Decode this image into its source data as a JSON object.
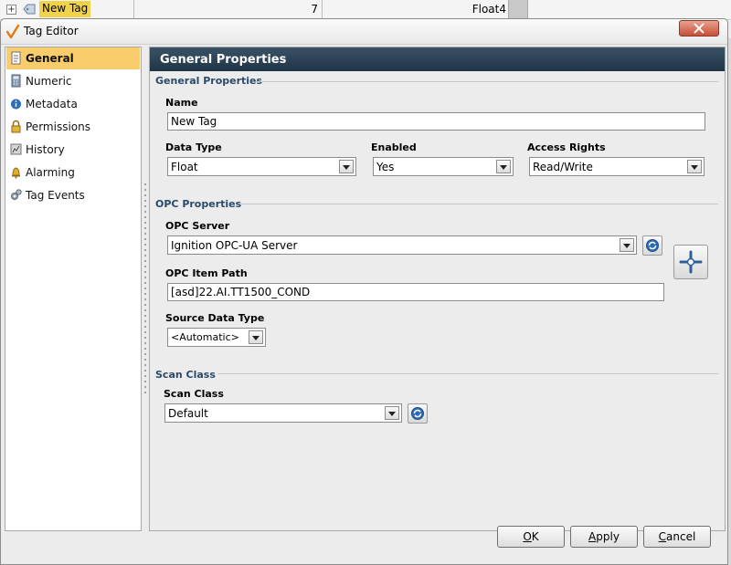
{
  "background_row": {
    "tag_name": "New Tag",
    "value": "7",
    "data_type": "Float4"
  },
  "dialog": {
    "title": "Tag Editor"
  },
  "nav": {
    "items": [
      {
        "label": "General",
        "icon": "document-icon",
        "selected": true
      },
      {
        "label": "Numeric",
        "icon": "calculator-icon",
        "selected": false
      },
      {
        "label": "Metadata",
        "icon": "info-icon",
        "selected": false
      },
      {
        "label": "Permissions",
        "icon": "lock-icon",
        "selected": false
      },
      {
        "label": "History",
        "icon": "history-icon",
        "selected": false
      },
      {
        "label": "Alarming",
        "icon": "bell-icon",
        "selected": false
      },
      {
        "label": "Tag Events",
        "icon": "gears-icon",
        "selected": false
      }
    ]
  },
  "main": {
    "header": "General Properties",
    "general": {
      "section_title": "General Properties",
      "name_label": "Name",
      "name_value": "New Tag",
      "data_type_label": "Data Type",
      "data_type_value": "Float",
      "enabled_label": "Enabled",
      "enabled_value": "Yes",
      "access_rights_label": "Access Rights",
      "access_rights_value": "Read/Write"
    },
    "opc": {
      "section_title": "OPC Properties",
      "server_label": "OPC Server",
      "server_value": "Ignition OPC-UA Server",
      "item_path_label": "OPC Item Path",
      "item_path_value": "[asd]22.AI.TT1500_COND",
      "source_type_label": "Source Data Type",
      "source_type_value": "<Automatic>"
    },
    "scan": {
      "section_title": "Scan Class",
      "scan_label": "Scan Class",
      "scan_value": "Default"
    }
  },
  "footer": {
    "ok_mnemonic": "O",
    "ok_rest": "K",
    "apply_mnemonic": "A",
    "apply_rest": "pply",
    "cancel_mnemonic": "C",
    "cancel_rest": "ancel"
  },
  "colors": {
    "selection": "#f9cd6c",
    "header_bg": "#2a4257",
    "section_title": "#2a4a6a",
    "close_button": "#c74f37"
  }
}
